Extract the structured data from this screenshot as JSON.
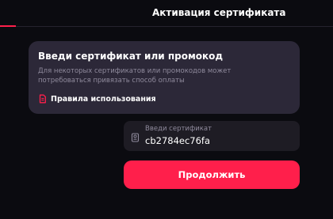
{
  "header": {
    "title": "Активация сертификата"
  },
  "info_card": {
    "title": "Введи сертификат или промокод",
    "description": "Для некоторых сертификатов или промокодов может потребоваться привязать способ оплаты",
    "rules_link_label": "Правила использования",
    "rules_icon": "document-icon"
  },
  "certificate_input": {
    "label": "Введи сертификат",
    "value": "cb2784ec76fa",
    "icon": "ticket-icon"
  },
  "continue_button": {
    "label": "Продолжить"
  },
  "colors": {
    "background": "#0b0b10",
    "card": "#2c2838",
    "input": "#1e1c24",
    "accent": "#ff1f4b",
    "muted_text": "#8f8a9c"
  }
}
